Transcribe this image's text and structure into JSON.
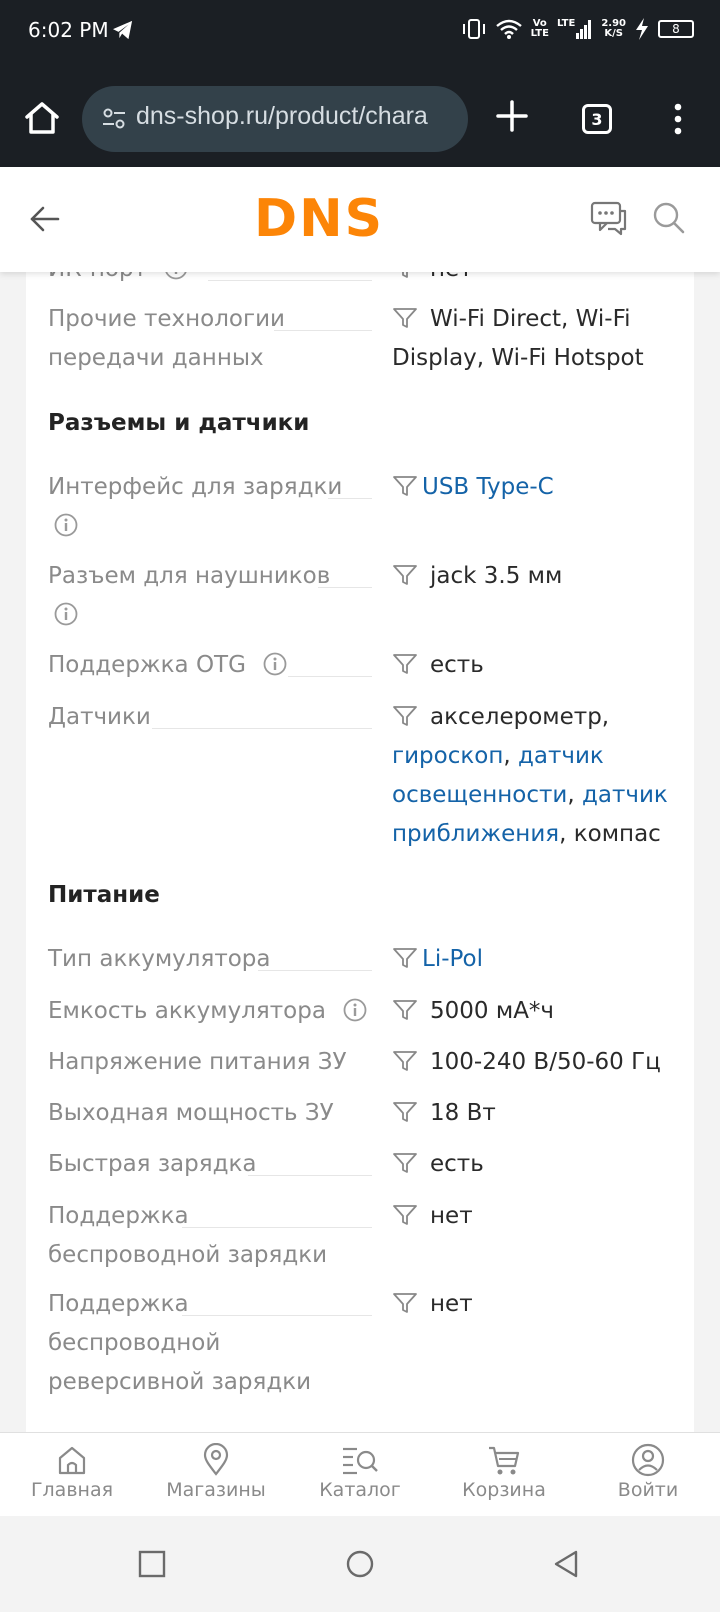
{
  "status_bar": {
    "time": "6:02 PM",
    "network_speed_value": "2.90",
    "network_speed_unit": "K/S",
    "battery_level": "8",
    "lte_label": "LTE",
    "volte_label_top": "Vo",
    "volte_label_bottom": "LTE"
  },
  "browser": {
    "url": "dns-shop.ru/product/chara",
    "tab_count": "3"
  },
  "header": {
    "logo_text": "DNS",
    "logo_color": "#fc8507"
  },
  "specs": {
    "partial_row": {
      "name": "ИК-порт",
      "value": "нет"
    },
    "other_tech": {
      "name_line1": "Прочие технологии",
      "name_line2": "передачи данных",
      "value_line1": "Wi-Fi Direct, Wi-Fi",
      "value_line2": "Display, Wi-Fi Hotspot"
    },
    "section_connectors": "Разъемы и датчики",
    "charging_interface": {
      "name": "Интерфейс для зарядки",
      "value": "USB Type-C"
    },
    "headphone_jack": {
      "name": "Разъем для наушников",
      "value": "jack 3.5 мм"
    },
    "otg": {
      "name": "Поддержка OTG",
      "value": "есть"
    },
    "sensors": {
      "name": "Датчики",
      "v1": "акселерометр,",
      "v2": "гироскоп",
      "v2sep": ", ",
      "v3a": "датчик",
      "v3b": "освещенности",
      "v3sep": ", ",
      "v4a": "датчик",
      "v4b": "приближения",
      "v5": ", компас"
    },
    "section_power": "Питание",
    "battery_type": {
      "name": "Тип аккумулятора",
      "value": "Li-Pol"
    },
    "battery_capacity": {
      "name": "Емкость аккумулятора",
      "value": "5000 мА*ч"
    },
    "charger_voltage": {
      "name": "Напряжение питания ЗУ",
      "value": "100-240 В/50-60 Гц"
    },
    "charger_power": {
      "name": "Выходная мощность ЗУ",
      "value": "18 Вт"
    },
    "fast_charge": {
      "name": "Быстрая зарядка",
      "value": "есть"
    },
    "wireless_charge": {
      "name_line1": "Поддержка",
      "name_line2": "беспроводной зарядки",
      "value": "нет"
    },
    "reverse_wireless": {
      "name_line1": "Поддержка",
      "name_line2": "беспроводной",
      "name_line3": "реверсивной зарядки",
      "value": "нет"
    }
  },
  "bottom_nav": {
    "home": "Главная",
    "stores": "Магазины",
    "catalog": "Каталог",
    "cart": "Корзина",
    "login": "Войти"
  },
  "colors": {
    "link": "#1463a8",
    "label": "#8a8a8a",
    "dark_bar": "#1b1f24"
  }
}
